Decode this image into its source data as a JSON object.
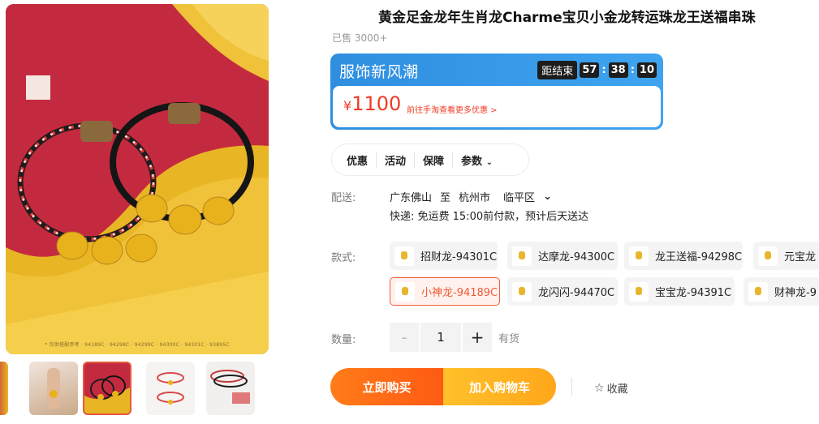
{
  "product": {
    "title": "黄金足金龙年生肖龙Charme宝贝小金龙转运珠龙王送福串珠",
    "sold": "已售 3000+"
  },
  "gallery": {
    "caption": "* 仅供搭配参考 · 94189C · 94298C · 94299C · 94300C · 94301C · 93895C",
    "thumbnail_count": 5,
    "active_thumbnail": 3
  },
  "promo": {
    "title": "服饰新风潮",
    "countdown_label": "距结束",
    "hours": "57",
    "minutes": "38",
    "seconds": "10",
    "currency": "¥",
    "price": "1100",
    "link_text": "前往手淘查看更多优惠 >",
    "colors": {
      "banner": "#3c9eea",
      "price": "#ef3b24"
    }
  },
  "tabs": [
    "优惠",
    "活动",
    "保障",
    "参数"
  ],
  "delivery": {
    "label": "配送:",
    "origin": "广东佛山",
    "to": "至",
    "city": "杭州市",
    "district": "临平区",
    "shipping": "快递: 免运费  15:00前付款，预计后天送达"
  },
  "styles": {
    "label": "款式:",
    "items": [
      "招财龙-94301C",
      "达摩龙-94300C",
      "龙王送福-94298C",
      "元宝龙",
      "小神龙-94189C",
      "龙闪闪-94470C",
      "宝宝龙-94391C",
      "财神龙-9"
    ],
    "selected": "小神龙-94189C"
  },
  "quantity": {
    "label": "数量:",
    "minus": "-",
    "value": "1",
    "plus": "+",
    "stock": "有货"
  },
  "actions": {
    "buy_now": "立即购买",
    "add_to_cart": "加入购物车",
    "favorite": "收藏",
    "favorite_icon": "star-outline-icon",
    "colors": {
      "buy": "#ff6a16",
      "cart": "#ffb321"
    }
  }
}
